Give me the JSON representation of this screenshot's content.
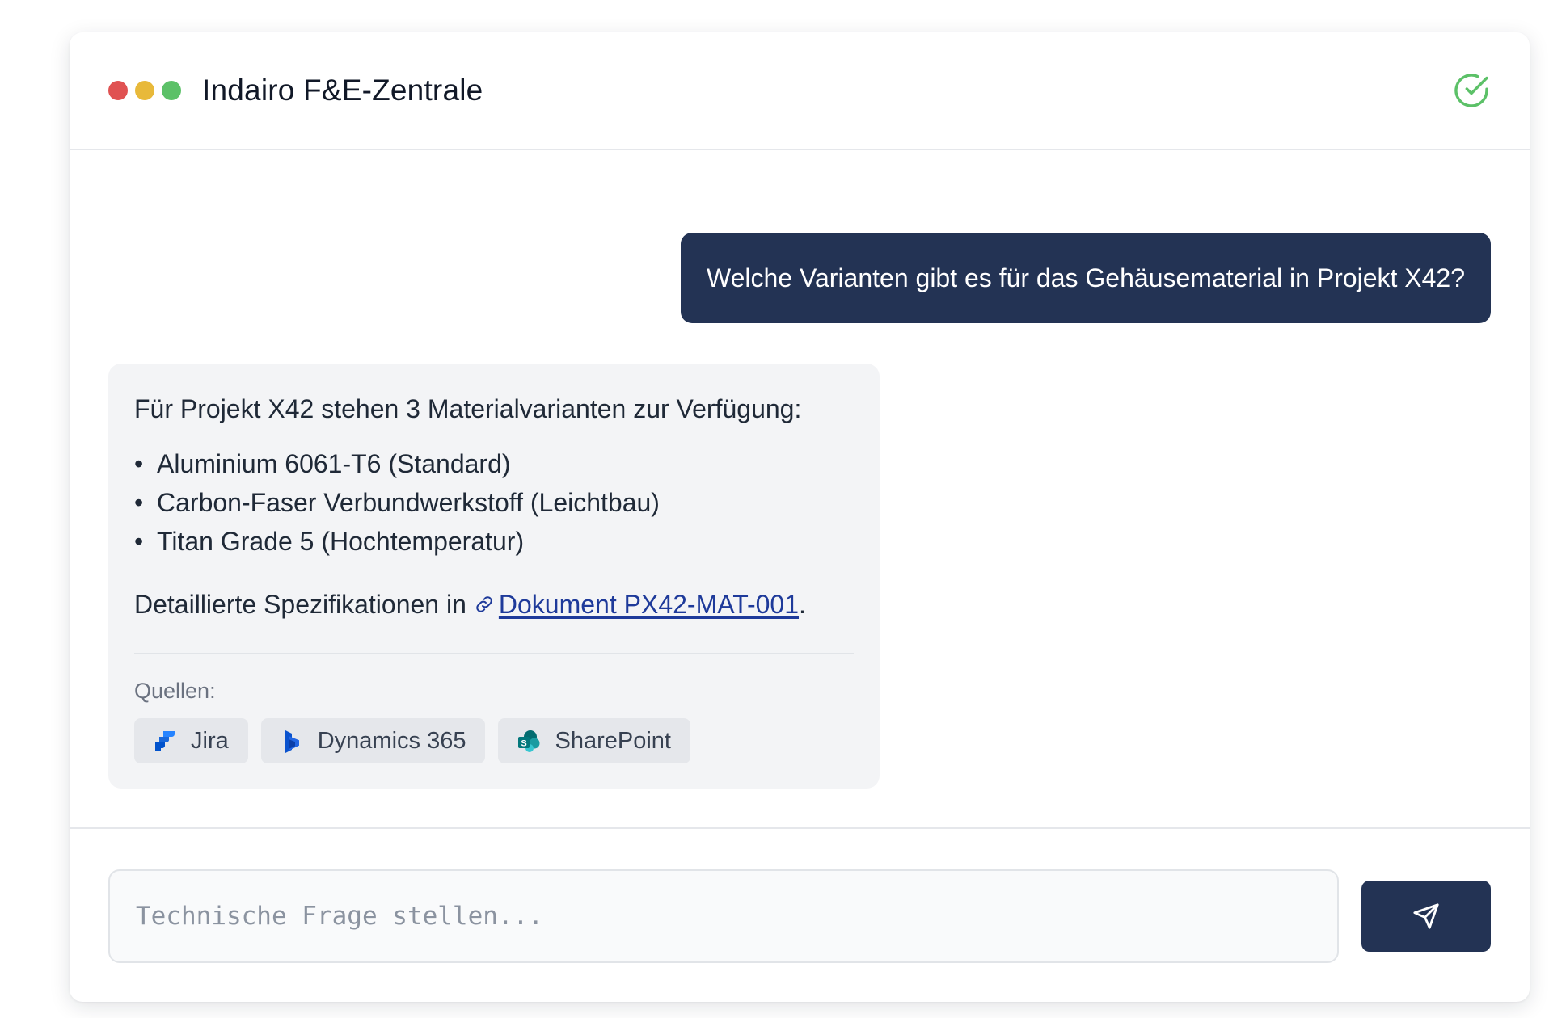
{
  "window": {
    "title": "Indairo F&E-Zentrale",
    "status_icon": "check-circle-icon",
    "status_color": "#5cc168"
  },
  "chat": {
    "user_message": "Welche Varianten gibt es für das Gehäusematerial in Projekt X42?",
    "bot": {
      "intro": "Für Projekt X42 stehen 3 Materialvarianten zur Verfügung:",
      "bullets": [
        "Aluminium 6061-T6 (Standard)",
        "Carbon-Faser Verbundwerkstoff (Leichtbau)",
        "Titan Grade 5 (Hochtemperatur)"
      ],
      "bullet_symbol": "•",
      "detail_prefix": "Detaillierte Spezifikationen in",
      "detail_link": "Dokument PX42-MAT-001",
      "detail_suffix": ".",
      "sources_label": "Quellen:",
      "sources": [
        {
          "label": "Jira",
          "icon": "jira-icon"
        },
        {
          "label": "Dynamics 365",
          "icon": "dynamics-365-icon"
        },
        {
          "label": "SharePoint",
          "icon": "sharepoint-icon"
        }
      ]
    }
  },
  "composer": {
    "placeholder": "Technische Frage stellen...",
    "value": "",
    "send_icon": "send-icon"
  },
  "colors": {
    "accent_navy": "#233354",
    "link": "#1e3a9a",
    "traffic_red": "#e05252",
    "traffic_yellow": "#e8b93a",
    "traffic_green": "#5cc168"
  }
}
